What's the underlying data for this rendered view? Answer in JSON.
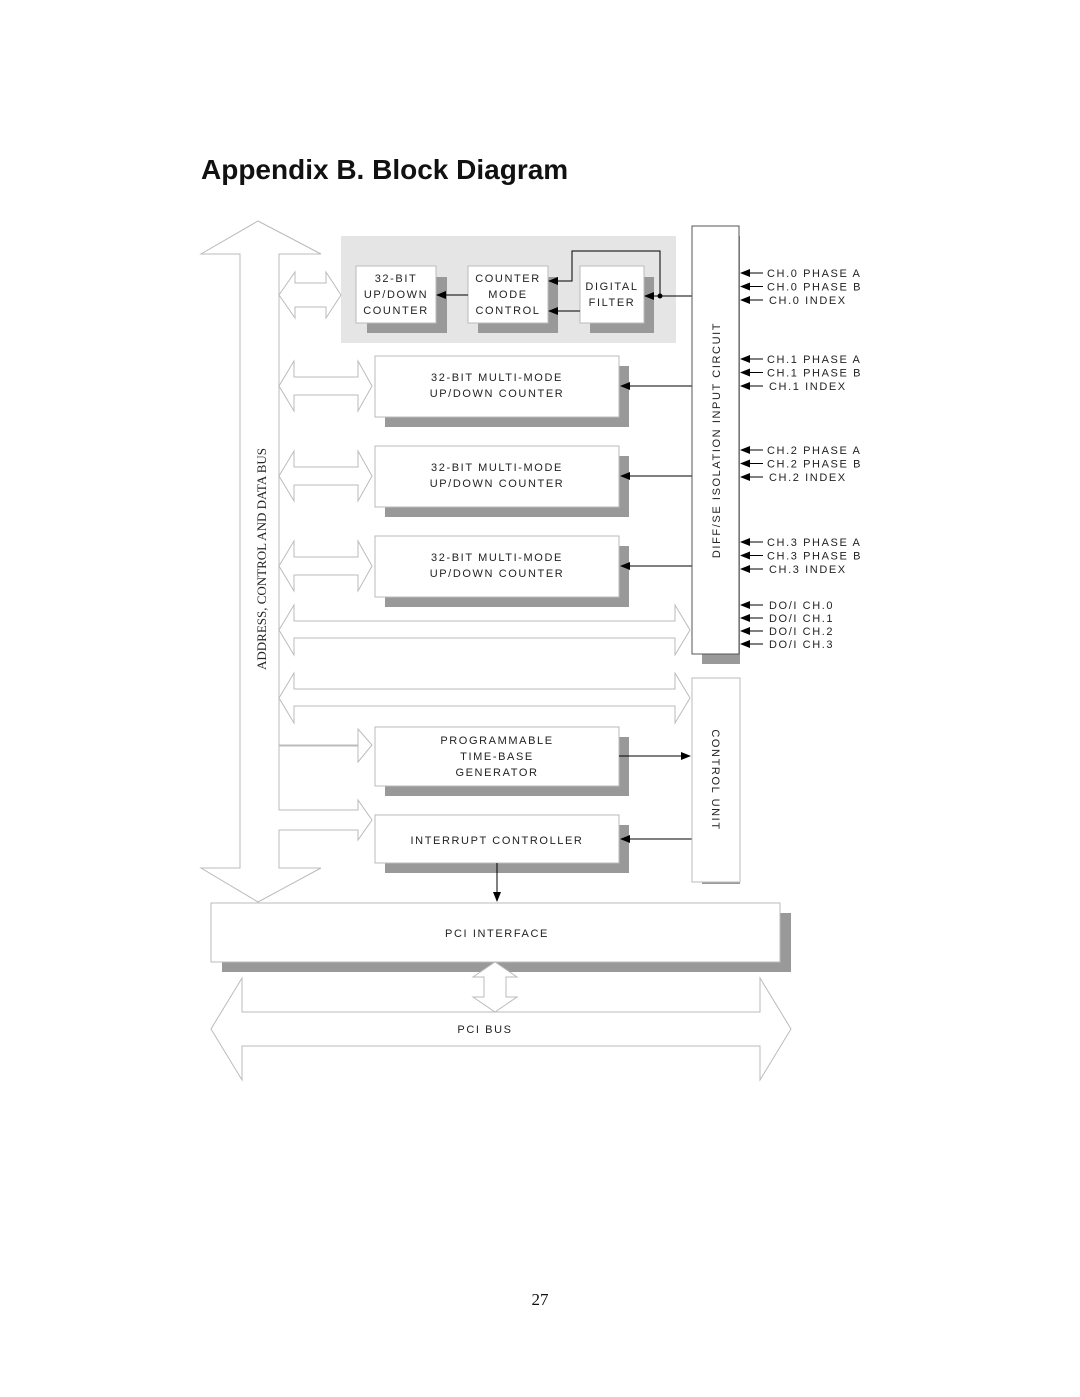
{
  "page": {
    "title": "Appendix B. Block Diagram",
    "page_number": "27"
  },
  "diagram": {
    "bus_label": "ADDRESS, CONTROL AND DATA BUS",
    "counter0": {
      "up_down_counter": [
        "32-BIT",
        "UP/DOWN",
        "COUNTER"
      ],
      "mode_control": [
        "COUNTER",
        "MODE",
        "CONTROL"
      ],
      "digital_filter": [
        "DIGITAL",
        "FILTER"
      ]
    },
    "multi_mode_counters": [
      {
        "line1": "32-BIT MULTI-MODE",
        "line2": "UP/DOWN COUNTER"
      },
      {
        "line1": "32-BIT MULTI-MODE",
        "line2": "UP/DOWN COUNTER"
      },
      {
        "line1": "32-BIT MULTI-MODE",
        "line2": "UP/DOWN COUNTER"
      }
    ],
    "time_base": [
      "PROGRAMMABLE",
      "TIME-BASE",
      "GENERATOR"
    ],
    "interrupt_controller": "INTERRUPT CONTROLLER",
    "isolation_circuit": "DIFF/SE ISOLATION INPUT CIRCUIT",
    "control_unit": "CONTROL UNIT",
    "pci_interface": "PCI INTERFACE",
    "pci_bus": "PCI BUS",
    "input_groups": [
      [
        "CH.0 PHASE A",
        "CH.0 PHASE B",
        "CH.0 INDEX"
      ],
      [
        "CH.1 PHASE A",
        "CH.1 PHASE B",
        "CH.1 INDEX"
      ],
      [
        "CH.2 PHASE A",
        "CH.2 PHASE B",
        "CH.2 INDEX"
      ],
      [
        "CH.3 PHASE A",
        "CH.3 PHASE B",
        "CH.3 INDEX"
      ],
      [
        "DO/I CH.0",
        "DO/I CH.1",
        "DO/I CH.2",
        "DO/I CH.3"
      ]
    ]
  }
}
